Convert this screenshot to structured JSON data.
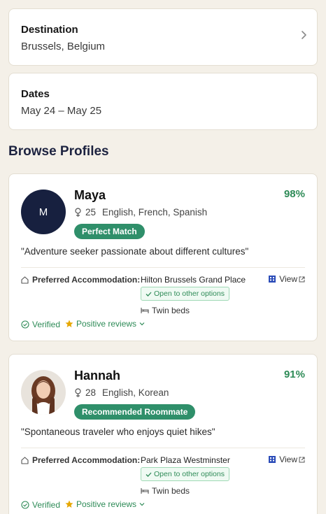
{
  "destination": {
    "label": "Destination",
    "value": "Brussels, Belgium"
  },
  "dates": {
    "label": "Dates",
    "value": "May 24 – May 25"
  },
  "browse": {
    "title": "Browse Profiles"
  },
  "profiles": [
    {
      "initial": "M",
      "name": "Maya",
      "match": "98%",
      "age": "25",
      "languages": "English, French, Spanish",
      "badge": "Perfect Match",
      "quote": "\"Adventure seeker passionate about different cultures\"",
      "accommodation_label": "Preferred Accommodation:",
      "accommodation": "Hilton Brussels Grand Place",
      "view_label": "View",
      "open_label": "Open to other options",
      "beds": "Twin beds",
      "verified": "Verified",
      "reviews": "Positive reviews"
    },
    {
      "initial": "",
      "name": "Hannah",
      "match": "91%",
      "age": "28",
      "languages": "English, Korean",
      "badge": "Recommended Roommate",
      "quote": "\"Spontaneous traveler who enjoys quiet hikes\"",
      "accommodation_label": "Preferred Accommodation:",
      "accommodation": "Park Plaza Westminster",
      "view_label": "View",
      "open_label": "Open to other options",
      "beds": "Twin beds",
      "verified": "Verified",
      "reviews": "Positive reviews"
    }
  ],
  "colors": {
    "accent_green": "#2e8b57",
    "badge_green": "#2f8f6a",
    "avatar_navy": "#17203f",
    "star_gold": "#e6a700",
    "page_bg": "#f4f0e8"
  },
  "icons": [
    "chevron-right-icon",
    "gender-female-icon",
    "home-icon",
    "building-icon",
    "external-link-icon",
    "check-icon",
    "bed-icon",
    "check-circle-icon",
    "star-icon",
    "chevron-down-icon"
  ]
}
